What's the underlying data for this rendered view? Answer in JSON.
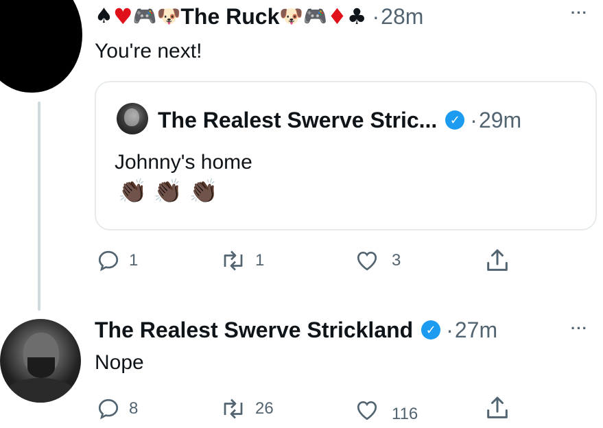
{
  "reply": {
    "name_prefix_emojis": [
      "♠",
      "♥",
      "🎮",
      "🐶"
    ],
    "display_name": "The Ruck",
    "name_suffix_emojis": [
      "🐶",
      "🎮",
      "♦",
      "♣"
    ],
    "separator": "·",
    "time": "28m",
    "text": "You're next!",
    "more_icon": "···"
  },
  "quoted": {
    "display_name": "The Realest Swerve Stric...",
    "verified_icon": "✓",
    "separator": "·",
    "time": "29m",
    "text": "Johnny's home",
    "emojis": [
      "👏🏿",
      "👏🏿",
      "👏🏿"
    ]
  },
  "reply_actions": {
    "replies": "1",
    "retweets": "1",
    "likes": "3"
  },
  "main": {
    "display_name": "The Realest Swerve Strickland",
    "verified_icon": "✓",
    "separator": "·",
    "time": "27m",
    "text": "Nope",
    "more_icon": "···"
  },
  "main_actions": {
    "replies": "8",
    "retweets": "26",
    "likes": "116"
  },
  "colors": {
    "accent_blue": "#1d9bf0",
    "muted": "#536471",
    "border": "#e7ebee",
    "heart": "#e0245e",
    "card_suit_red": "#e0111b"
  }
}
